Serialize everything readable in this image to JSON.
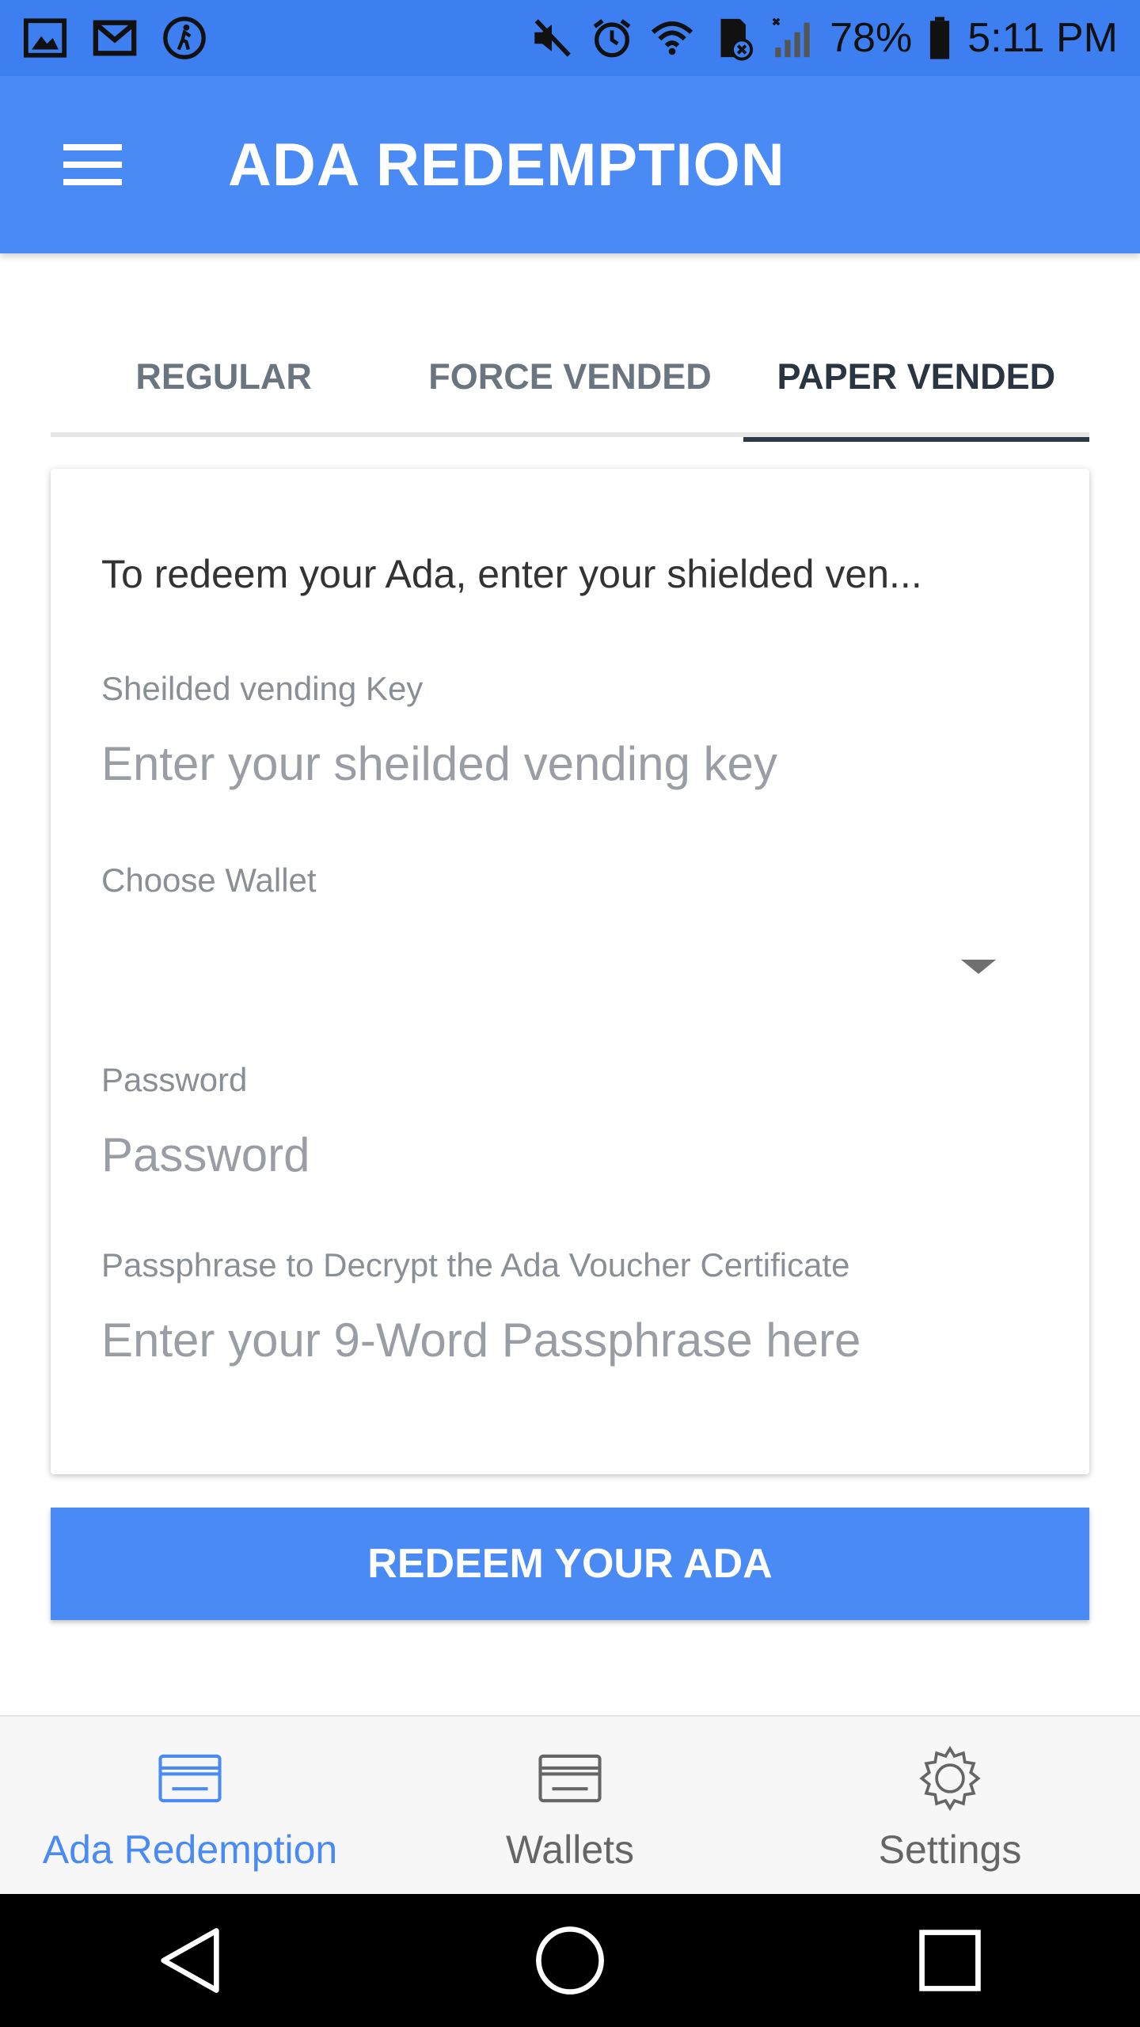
{
  "status_bar": {
    "battery": "78%",
    "time": "5:11 PM"
  },
  "app_bar": {
    "title": "ADA REDEMPTION"
  },
  "tabs": [
    {
      "label": "REGULAR",
      "active": false
    },
    {
      "label": "FORCE VENDED",
      "active": false
    },
    {
      "label": "PAPER VENDED",
      "active": true
    }
  ],
  "form": {
    "intro": "To redeem your Ada, enter your shielded ven...",
    "vending_key": {
      "label": "Sheilded vending Key",
      "placeholder": "Enter your sheilded vending key",
      "value": ""
    },
    "wallet": {
      "label": "Choose Wallet",
      "value": ""
    },
    "password": {
      "label": "Password",
      "placeholder": "Password",
      "value": ""
    },
    "passphrase": {
      "label": "Passphrase to Decrypt the Ada Voucher Certificate",
      "placeholder": "Enter your 9-Word Passphrase here",
      "value": ""
    }
  },
  "redeem_button": {
    "label": "REDEEM YOUR ADA"
  },
  "bottom_nav": [
    {
      "label": "Ada Redemption",
      "icon": "card-icon",
      "active": true
    },
    {
      "label": "Wallets",
      "icon": "wallet-card-icon",
      "active": false
    },
    {
      "label": "Settings",
      "icon": "gear-icon",
      "active": false
    }
  ],
  "colors": {
    "primary": "#4a8af4",
    "status_bar": "#3d7ff0",
    "tab_active": "#2f3846"
  }
}
